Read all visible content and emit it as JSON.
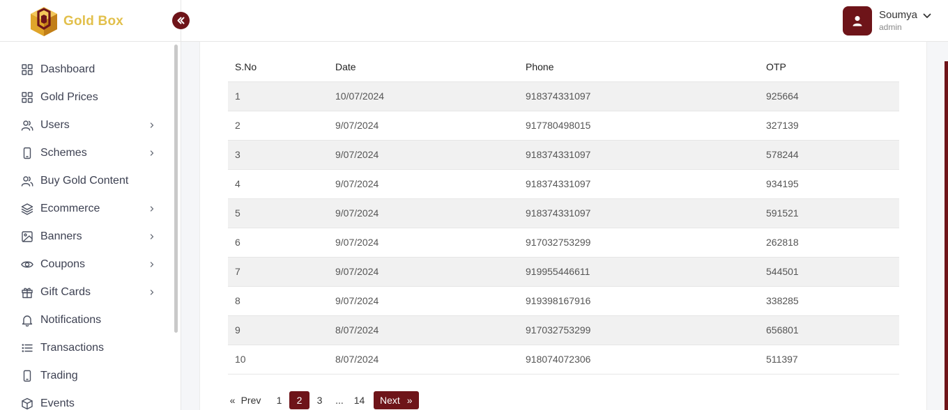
{
  "brand": {
    "name": "Gold Box"
  },
  "user": {
    "name": "Soumya",
    "role": "admin"
  },
  "sidebar": {
    "items": [
      {
        "label": "Dashboard",
        "icon": "grid-icon",
        "has_arrow": false
      },
      {
        "label": "Gold Prices",
        "icon": "grid-icon",
        "has_arrow": false
      },
      {
        "label": "Users",
        "icon": "users-icon",
        "has_arrow": true
      },
      {
        "label": "Schemes",
        "icon": "phone-icon",
        "has_arrow": true
      },
      {
        "label": "Buy Gold Content",
        "icon": "users-icon",
        "has_arrow": false
      },
      {
        "label": "Ecommerce",
        "icon": "layers-icon",
        "has_arrow": true
      },
      {
        "label": "Banners",
        "icon": "image-icon",
        "has_arrow": true
      },
      {
        "label": "Coupons",
        "icon": "eye-icon",
        "has_arrow": true
      },
      {
        "label": "Gift Cards",
        "icon": "gift-icon",
        "has_arrow": true
      },
      {
        "label": "Notifications",
        "icon": "bell-icon",
        "has_arrow": false
      },
      {
        "label": "Transactions",
        "icon": "list-icon",
        "has_arrow": false
      },
      {
        "label": "Trading",
        "icon": "phone-icon",
        "has_arrow": false
      },
      {
        "label": "Events",
        "icon": "box-icon",
        "has_arrow": false
      }
    ]
  },
  "table": {
    "columns": [
      "S.No",
      "Date",
      "Phone",
      "OTP"
    ],
    "rows": [
      [
        "1",
        "10/07/2024",
        "918374331097",
        "925664"
      ],
      [
        "2",
        "9/07/2024",
        "917780498015",
        "327139"
      ],
      [
        "3",
        "9/07/2024",
        "918374331097",
        "578244"
      ],
      [
        "4",
        "9/07/2024",
        "918374331097",
        "934195"
      ],
      [
        "5",
        "9/07/2024",
        "918374331097",
        "591521"
      ],
      [
        "6",
        "9/07/2024",
        "917032753299",
        "262818"
      ],
      [
        "7",
        "9/07/2024",
        "919955446611",
        "544501"
      ],
      [
        "8",
        "9/07/2024",
        "919398167916",
        "338285"
      ],
      [
        "9",
        "8/07/2024",
        "917032753299",
        "656801"
      ],
      [
        "10",
        "8/07/2024",
        "918074072306",
        "511397"
      ]
    ]
  },
  "pagination": {
    "prev_label": "Prev",
    "prev_glyph": "«",
    "pages": [
      "1",
      "2",
      "3",
      "...",
      "14"
    ],
    "active_page": "2",
    "next_label": "Next",
    "next_glyph": "»"
  },
  "colors": {
    "accent": "#6e1419",
    "brand_gold": "#e2c04c",
    "row_alt": "#f1f1f1"
  }
}
